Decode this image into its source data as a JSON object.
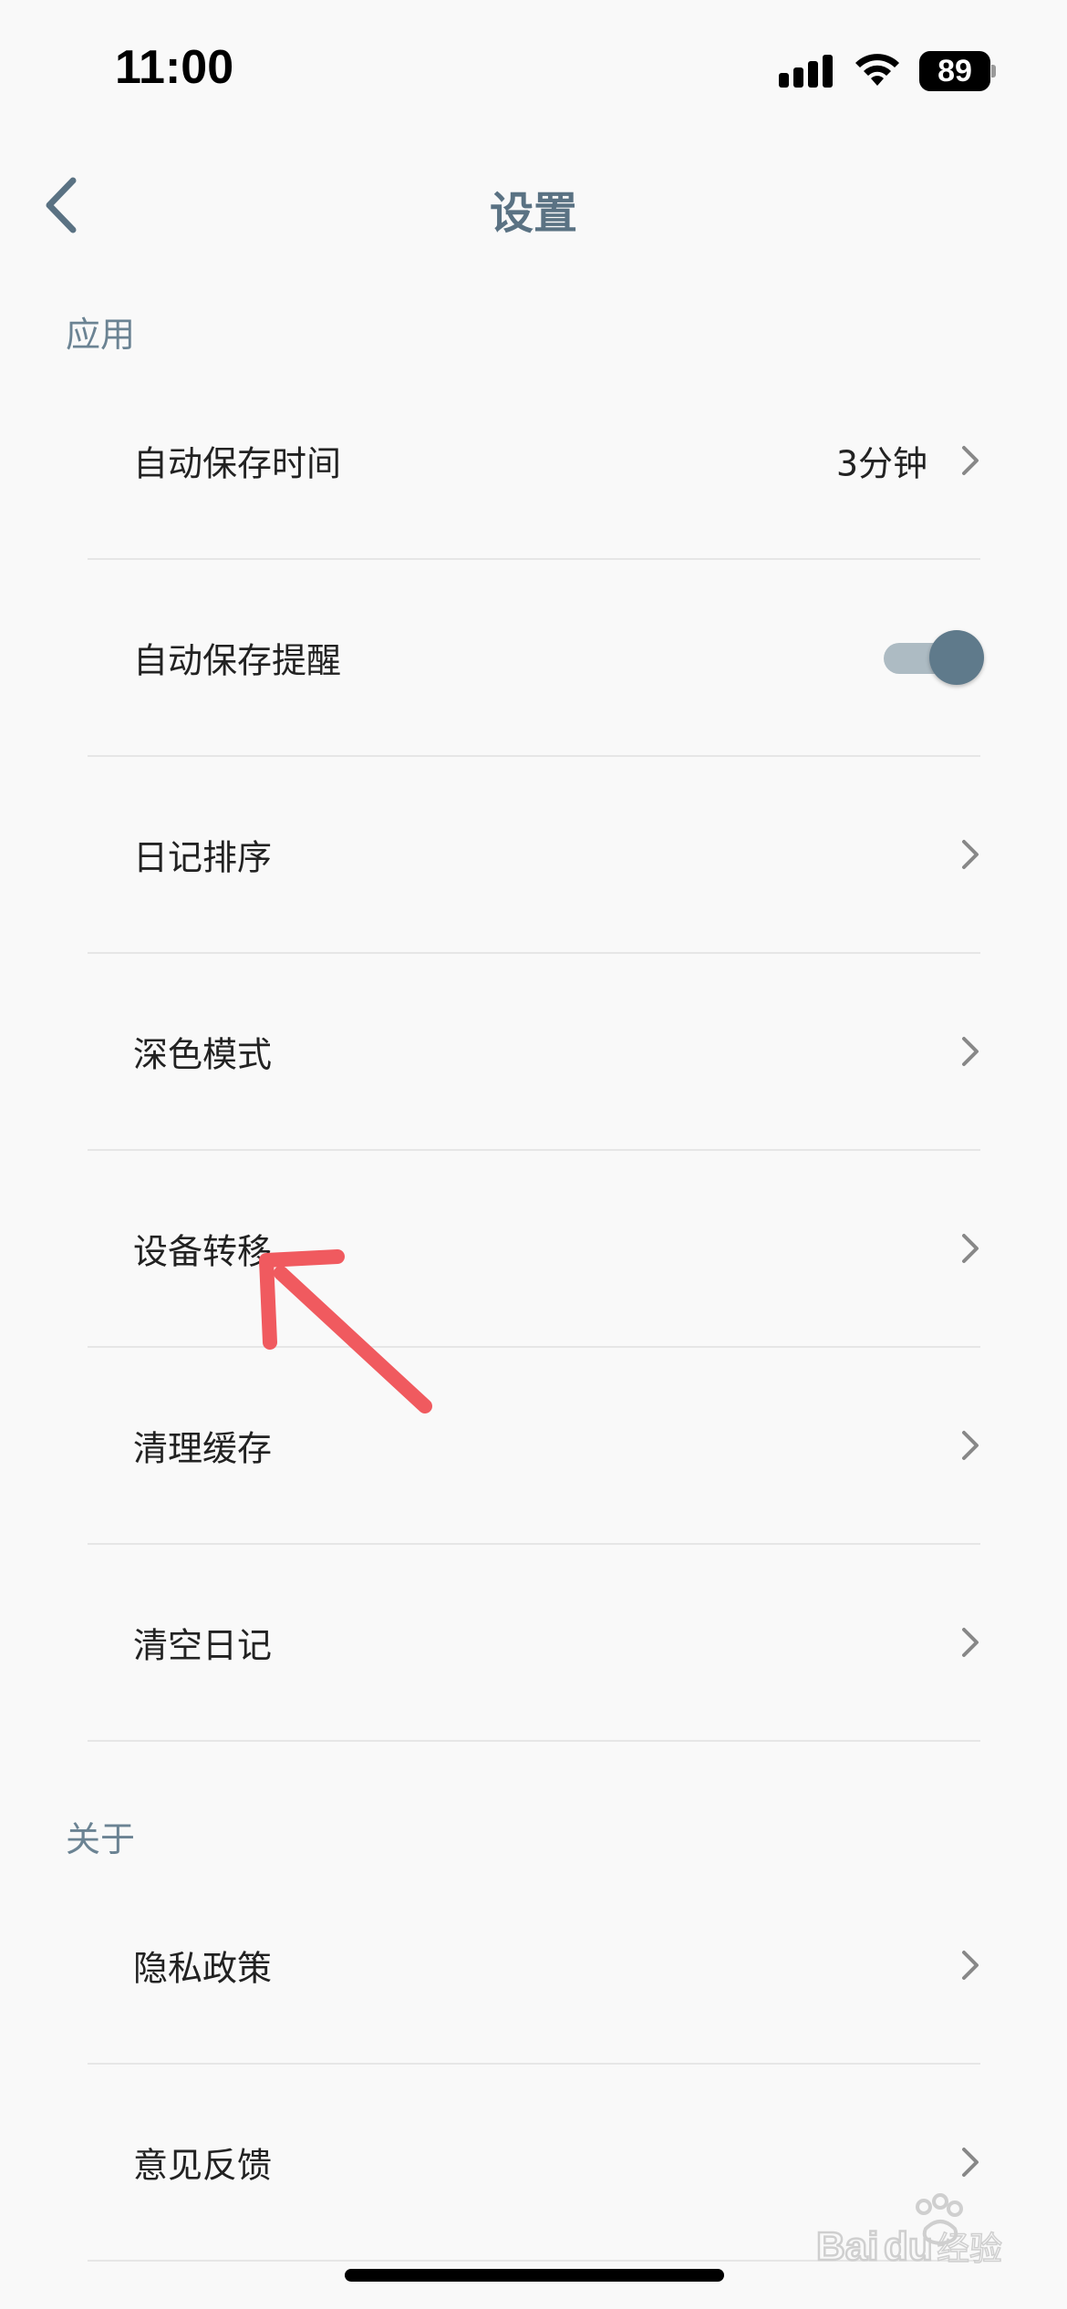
{
  "status_bar": {
    "time": "11:00",
    "battery_level": "89",
    "signal_icon": "cellular-signal-icon",
    "wifi_icon": "wifi-icon"
  },
  "nav": {
    "title": "设置",
    "back_icon": "chevron-left-icon"
  },
  "sections": {
    "app": {
      "header": "应用",
      "rows": {
        "auto_save_time": {
          "label": "自动保存时间",
          "value": "3分钟"
        },
        "auto_save_reminder": {
          "label": "自动保存提醒",
          "toggle_on": true
        },
        "diary_sort": {
          "label": "日记排序"
        },
        "dark_mode": {
          "label": "深色模式"
        },
        "device_transfer": {
          "label": "设备转移"
        },
        "clear_cache": {
          "label": "清理缓存"
        },
        "clear_diary": {
          "label": "清空日记"
        }
      }
    },
    "about": {
      "header": "关于",
      "rows": {
        "privacy_policy": {
          "label": "隐私政策"
        },
        "feedback": {
          "label": "意见反馈"
        }
      }
    }
  },
  "watermark": {
    "text": "Baidu经验"
  },
  "colors": {
    "accent": "#5f7a8b",
    "annotation_arrow": "#f05a5f",
    "background": "#f9f9f9"
  }
}
